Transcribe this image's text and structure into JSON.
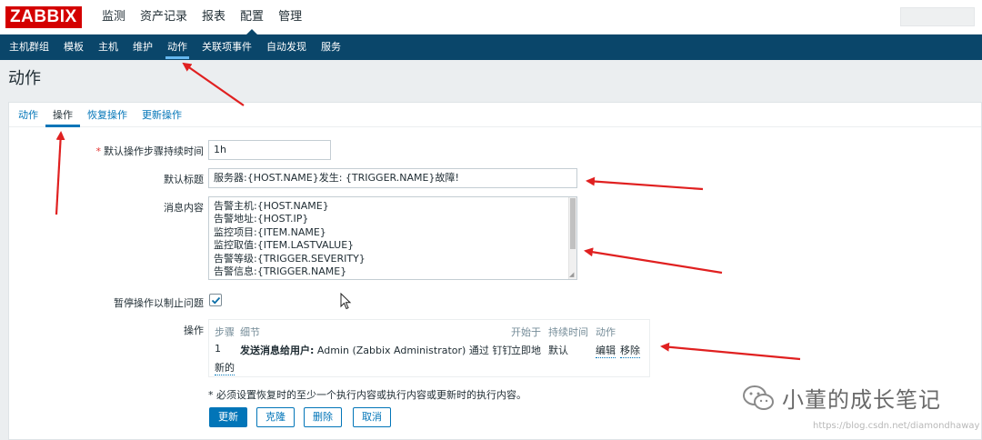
{
  "header": {
    "logo": "ZABBIX",
    "menu": [
      "监测",
      "资产记录",
      "报表",
      "配置",
      "管理"
    ],
    "active_menu": "配置"
  },
  "submenu": [
    "主机群组",
    "模板",
    "主机",
    "维护",
    "动作",
    "关联项事件",
    "自动发现",
    "服务"
  ],
  "page_title": "动作",
  "tabs": [
    "动作",
    "操作",
    "恢复操作",
    "更新操作"
  ],
  "form": {
    "step_duration_label": "默认操作步骤持续时间",
    "step_duration_value": "1h",
    "subject_label": "默认标题",
    "subject_value": "服务器:{HOST.NAME}发生: {TRIGGER.NAME}故障!",
    "message_label": "消息内容",
    "message_lines": [
      "告警主机:{HOST.NAME}",
      "告警地址:{HOST.IP}",
      "监控项目:{ITEM.NAME}",
      "监控取值:{ITEM.LASTVALUE}",
      "告警等级:{TRIGGER.SEVERITY}",
      "告警信息:{TRIGGER.NAME}"
    ],
    "pause_label": "暂停操作以制止问题",
    "pause_checked": true,
    "operations_label": "操作",
    "operations": {
      "headers": [
        "步骤",
        "细节",
        "开始于",
        "持续时间",
        "动作"
      ],
      "row": {
        "step": "1",
        "detail_bold": "发送消息给用户:",
        "detail_rest": " Admin (Zabbix Administrator) 通过 钉钉",
        "start": "立即地",
        "duration": "默认",
        "edit": "编辑",
        "remove": "移除"
      },
      "new_link": "新的"
    },
    "note": "* 必须设置恢复时的至少一个执行内容或执行内容或更新时的执行内容。",
    "buttons": [
      "更新",
      "克隆",
      "删除",
      "取消"
    ]
  },
  "watermark": {
    "text": "小董的成长笔记",
    "url": "https://blog.csdn.net/diamondhaway"
  },
  "colors": {
    "brand": "#d40000",
    "nav": "#0a466a",
    "link": "#0275b8",
    "annotation_arrow": "#e02020"
  }
}
